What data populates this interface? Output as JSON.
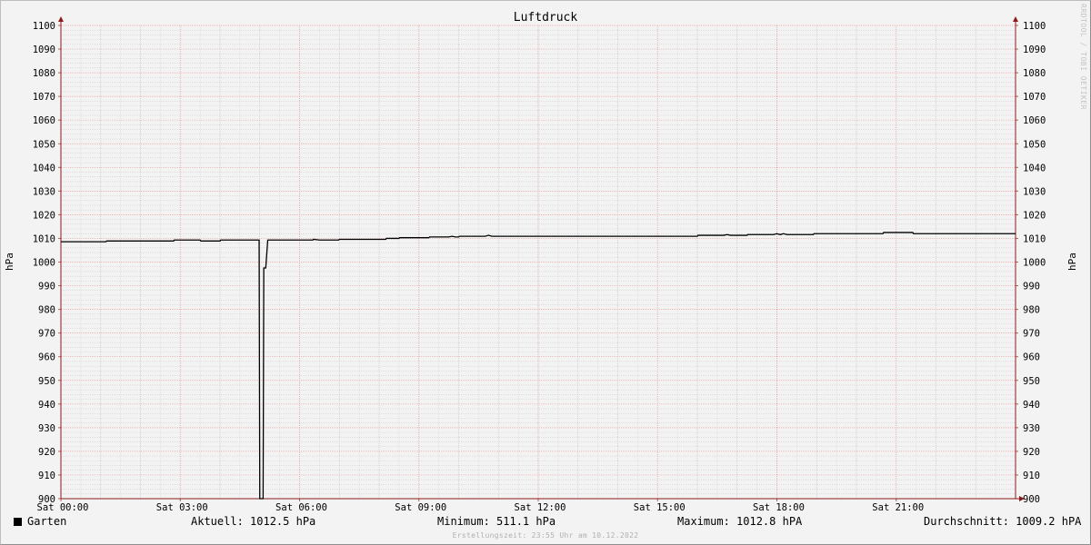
{
  "chart_data": {
    "type": "line",
    "title": "Luftdruck",
    "ylabel": "hPa",
    "ylabel_right": "hPa",
    "ylim": [
      900,
      1100
    ],
    "y_ticks": [
      900,
      910,
      920,
      930,
      940,
      950,
      960,
      970,
      980,
      990,
      1000,
      1010,
      1020,
      1030,
      1040,
      1050,
      1060,
      1070,
      1080,
      1090,
      1100
    ],
    "xlim": [
      "00:00",
      "24:00"
    ],
    "x_ticks": [
      {
        "label": "Sat 00:00",
        "t": "00:00"
      },
      {
        "label": "Sat 03:00",
        "t": "03:00"
      },
      {
        "label": "Sat 06:00",
        "t": "06:00"
      },
      {
        "label": "Sat 09:00",
        "t": "09:00"
      },
      {
        "label": "Sat 12:00",
        "t": "12:00"
      },
      {
        "label": "Sat 15:00",
        "t": "15:00"
      },
      {
        "label": "Sat 18:00",
        "t": "18:00"
      },
      {
        "label": "Sat 21:00",
        "t": "21:00"
      }
    ],
    "grid": true,
    "series": [
      {
        "name": "Garten",
        "color": "#000000",
        "points": [
          [
            "00:00",
            1008.6
          ],
          [
            "01:08",
            1008.6
          ],
          [
            "01:09",
            1008.9
          ],
          [
            "02:50",
            1008.9
          ],
          [
            "02:51",
            1009.3
          ],
          [
            "03:30",
            1009.3
          ],
          [
            "03:31",
            1008.9
          ],
          [
            "04:00",
            1008.9
          ],
          [
            "04:01",
            1009.3
          ],
          [
            "04:59",
            1009.3
          ],
          [
            "05:00",
            900.0
          ],
          [
            "05:05",
            900.0
          ],
          [
            "05:06",
            997.5
          ],
          [
            "05:09",
            997.5
          ],
          [
            "05:12",
            1009.3
          ],
          [
            "06:20",
            1009.3
          ],
          [
            "06:21",
            1009.6
          ],
          [
            "06:30",
            1009.3
          ],
          [
            "06:59",
            1009.3
          ],
          [
            "07:00",
            1009.6
          ],
          [
            "08:10",
            1009.6
          ],
          [
            "08:11",
            1010.0
          ],
          [
            "08:30",
            1010.0
          ],
          [
            "08:31",
            1010.3
          ],
          [
            "09:15",
            1010.3
          ],
          [
            "09:16",
            1010.6
          ],
          [
            "09:45",
            1010.6
          ],
          [
            "09:50",
            1010.9
          ],
          [
            "09:55",
            1010.6
          ],
          [
            "10:00",
            1010.6
          ],
          [
            "10:01",
            1010.9
          ],
          [
            "10:40",
            1010.9
          ],
          [
            "10:45",
            1011.3
          ],
          [
            "10:50",
            1010.9
          ],
          [
            "16:00",
            1010.9
          ],
          [
            "16:01",
            1011.3
          ],
          [
            "16:40",
            1011.3
          ],
          [
            "16:45",
            1011.6
          ],
          [
            "16:50",
            1011.3
          ],
          [
            "17:15",
            1011.3
          ],
          [
            "17:16",
            1011.6
          ],
          [
            "17:55",
            1011.6
          ],
          [
            "18:00",
            1012.0
          ],
          [
            "18:05",
            1011.6
          ],
          [
            "18:10",
            1012.0
          ],
          [
            "18:15",
            1011.6
          ],
          [
            "18:55",
            1011.6
          ],
          [
            "18:56",
            1012.0
          ],
          [
            "20:40",
            1012.0
          ],
          [
            "20:41",
            1012.5
          ],
          [
            "21:25",
            1012.5
          ],
          [
            "21:26",
            1012.0
          ],
          [
            "24:00",
            1012.0
          ]
        ]
      }
    ]
  },
  "legend": {
    "series_name": "Garten",
    "current": "Aktuell: 1012.5 hPa",
    "minimum": "Minimum: 511.1 hPa",
    "maximum": "Maximum: 1012.8 hPA",
    "average": "Durchschnitt: 1009.2 hPA"
  },
  "footer": "Erstellungszeit: 23:55 Uhr am 10.12.2022",
  "watermark": "RRDTOOL / TOBI OETIKER"
}
